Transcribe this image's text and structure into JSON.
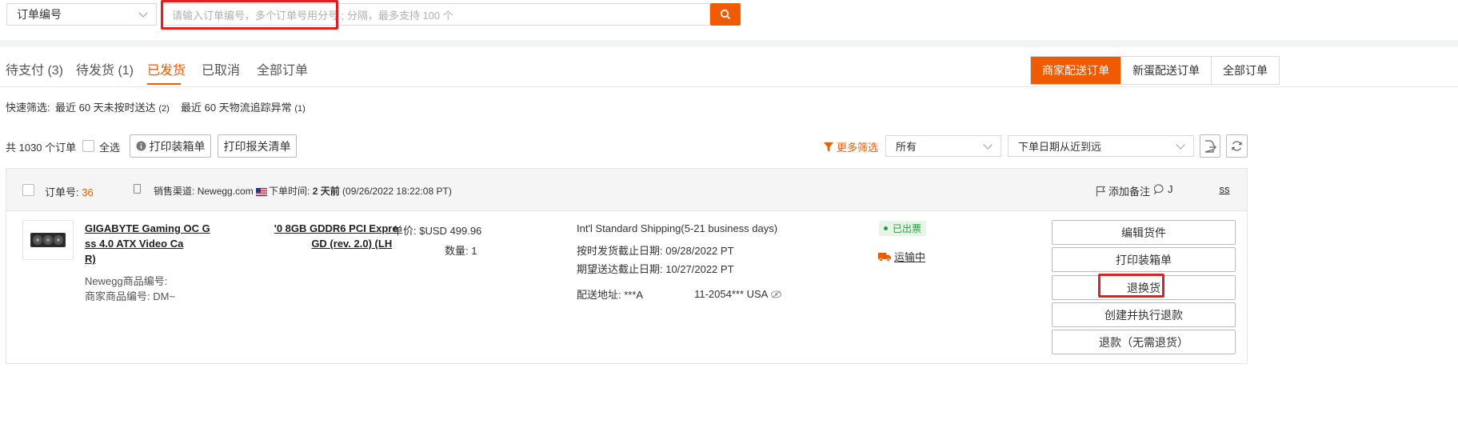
{
  "search": {
    "field_select": "订单编号",
    "placeholder": "请输入订单编号，多个订单号用分号 ; 分隔，最多支持 100 个"
  },
  "tabs": [
    {
      "label": "待支付 (3)"
    },
    {
      "label": "待发货 (1)"
    },
    {
      "label": "已发货"
    },
    {
      "label": "已取消"
    },
    {
      "label": "全部订单"
    }
  ],
  "delivery_filter": [
    "商家配送订单",
    "新蛋配送订单",
    "全部订单"
  ],
  "quick_filter": {
    "label": "快速筛选:",
    "item1": "最近 60 天未按时送达",
    "item1_count": "(2)",
    "item2": "最近 60 天物流追踪异常",
    "item2_count": "(1)"
  },
  "toolbar": {
    "total": "共 1030 个订单",
    "select_all": "全选",
    "print_packing": "打印装箱单",
    "print_customs": "打印报关清单",
    "more_filter": "更多筛选",
    "status_select": "所有",
    "sort_select": "下单日期从近到远"
  },
  "order": {
    "order_no_label": "订单号:",
    "order_no": "36",
    "channel_label": "销售渠道:",
    "channel": "Newegg.com",
    "time_label": "下单时间:",
    "time_rel": "2 天前",
    "time_abs": "(09/26/2022 18:22:08 PT)",
    "add_note": "添加备注",
    "buyer_prefix": "J",
    "buyer_suffix": "ss",
    "product_line1a": "GIGABYTE Gaming OC G",
    "product_line1b": "'0 8GB GDDR6 PCI Expre",
    "product_line2a": "ss 4.0 ATX Video Ca",
    "product_line2b": "GD (rev. 2.0) (LH",
    "product_line3": "R)",
    "newegg_item_label": "Newegg商品编号:",
    "seller_item_label": "商家商品编号: DM~",
    "unit_price": "单价: $USD 499.96",
    "quantity": "数量: 1",
    "shipping_service": "Int'l Standard Shipping(5-21 business days)",
    "ship_by": "按时发货截止日期: 09/28/2022 PT",
    "deliver_by": "期望送达截止日期: 10/27/2022 PT",
    "address_label": "配送地址: ***A",
    "address_tail": "11-2054*** USA",
    "invoice_status": "已出票",
    "shipping_status": "运输中",
    "actions": [
      "编辑货件",
      "打印装箱单",
      "退换货",
      "创建并执行退款",
      "退款（无需退货）"
    ]
  },
  "colors": {
    "accent": "#f05a00",
    "highlight": "#e02020",
    "success": "#2e9b3e"
  }
}
